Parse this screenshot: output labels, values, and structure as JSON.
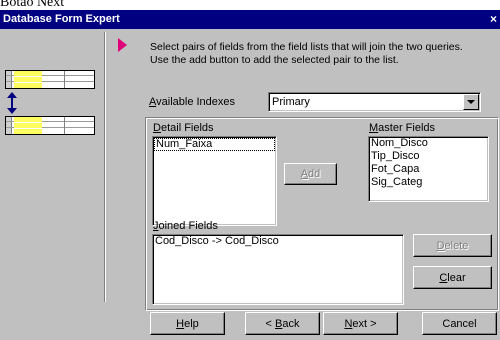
{
  "caption": "Botão Next",
  "window": {
    "title": "Database Form Expert",
    "close_symbol": "×"
  },
  "instructions": "Select pairs of fields from the field lists that will join the two queries.  Use the add button to add the selected pair to the list.",
  "available_indexes": {
    "label_pre": "",
    "label_mnemonic": "A",
    "label_post": "vailable Indexes",
    "selected": "Primary"
  },
  "detail_fields": {
    "label_pre": "",
    "label_mnemonic": "D",
    "label_post": "etail Fields",
    "items": [
      "Num_Faixa"
    ]
  },
  "master_fields": {
    "label_pre": "",
    "label_mnemonic": "M",
    "label_post": "aster Fields",
    "items": [
      "Nom_Disco",
      "Tip_Disco",
      "Fot_Capa",
      "Sig_Categ"
    ]
  },
  "add_button": {
    "mnemonic": "A",
    "rest": "dd"
  },
  "joined_fields": {
    "label_pre": "",
    "label_mnemonic": "J",
    "label_post": "oined Fields",
    "items": [
      "Cod_Disco -> Cod_Disco"
    ]
  },
  "delete_button": {
    "mnemonic": "D",
    "rest": "elete"
  },
  "clear_button": {
    "mnemonic": "C",
    "rest": "lear"
  },
  "footer": {
    "help": {
      "mnemonic": "H",
      "rest": "elp"
    },
    "back": {
      "prefix": "< ",
      "mnemonic": "B",
      "rest": "ack"
    },
    "next": {
      "mnemonic": "N",
      "rest": "ext >"
    },
    "cancel": "Cancel"
  },
  "colors": {
    "titlebar": "#000080",
    "arrow": "#e0007a",
    "illustration_highlight": "#ffff60",
    "illustration_arrow": "#000080"
  }
}
